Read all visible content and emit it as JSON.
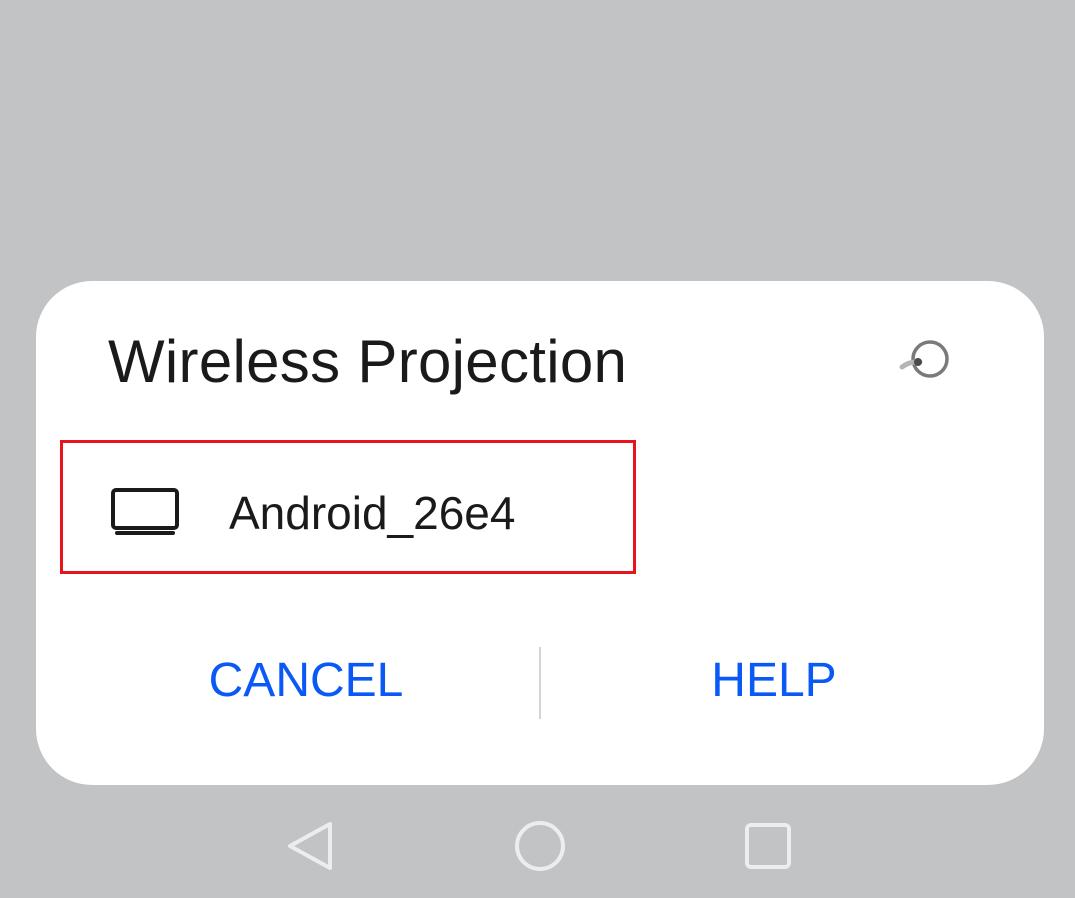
{
  "dialog": {
    "title": "Wireless Projection",
    "refresh_icon": "refresh-spinner-icon",
    "devices": [
      {
        "name": "Android_26e4",
        "icon": "tv-icon"
      }
    ],
    "cancel_label": "CANCEL",
    "help_label": "HELP"
  },
  "navigation_bar": {
    "back_icon": "back-triangle-icon",
    "home_icon": "home-circle-icon",
    "recents_icon": "recents-square-icon"
  },
  "colors": {
    "backdrop": "#c2c3c5",
    "dialog_bg": "#ffffff",
    "accent": "#0a59f7",
    "highlight_border": "#e8141c",
    "text": "#1a1a1a"
  }
}
